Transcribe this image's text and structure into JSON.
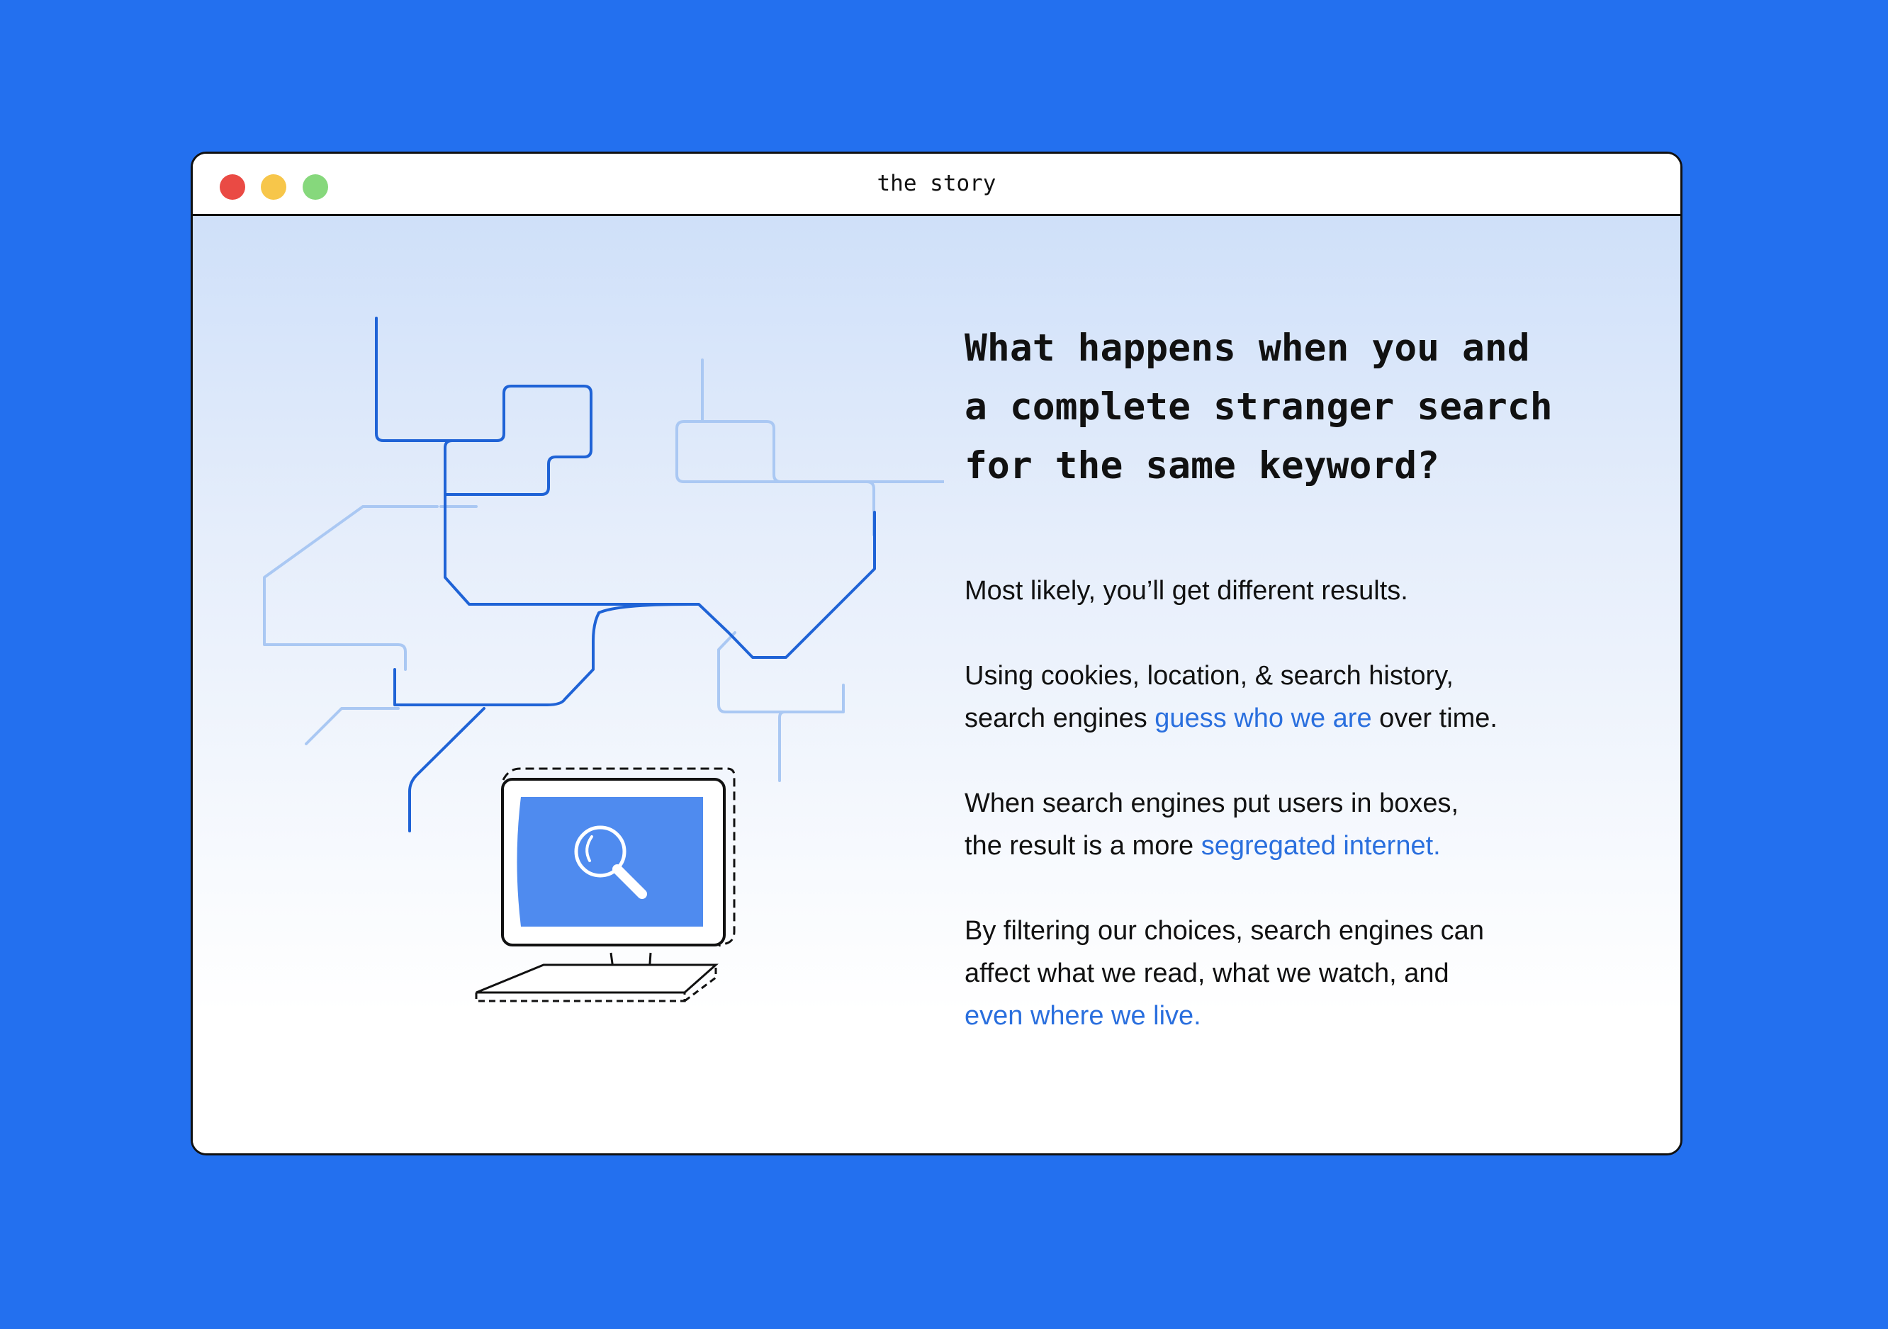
{
  "window": {
    "title": "the story",
    "controls": [
      "close",
      "minimize",
      "maximize"
    ]
  },
  "headline": "What happens when you and\na complete stranger search\nfor the same keyword?",
  "paragraphs": {
    "p1": {
      "text": "Most likely, you’ll get different results."
    },
    "p2": {
      "line1": "Using cookies, location, & search history,",
      "before": "search engines ",
      "link": "guess who we are",
      "after": " over time."
    },
    "p3": {
      "line1": "When search engines put users in boxes,",
      "before": "the result is a more ",
      "link": "segregated internet."
    },
    "p4": {
      "line1": "By filtering our choices, search engines can",
      "line2": "affect what we read, what we watch, and",
      "link": "even where we live."
    }
  },
  "illustration": {
    "icons": [
      "network-lines",
      "computer-monitor",
      "magnifier-icon",
      "keyboard"
    ]
  },
  "colors": {
    "background": "#2370ef",
    "link": "#2a6fde",
    "line_dark": "#1f63d6",
    "line_light": "#aac8f3",
    "screen": "#4f8bef"
  }
}
